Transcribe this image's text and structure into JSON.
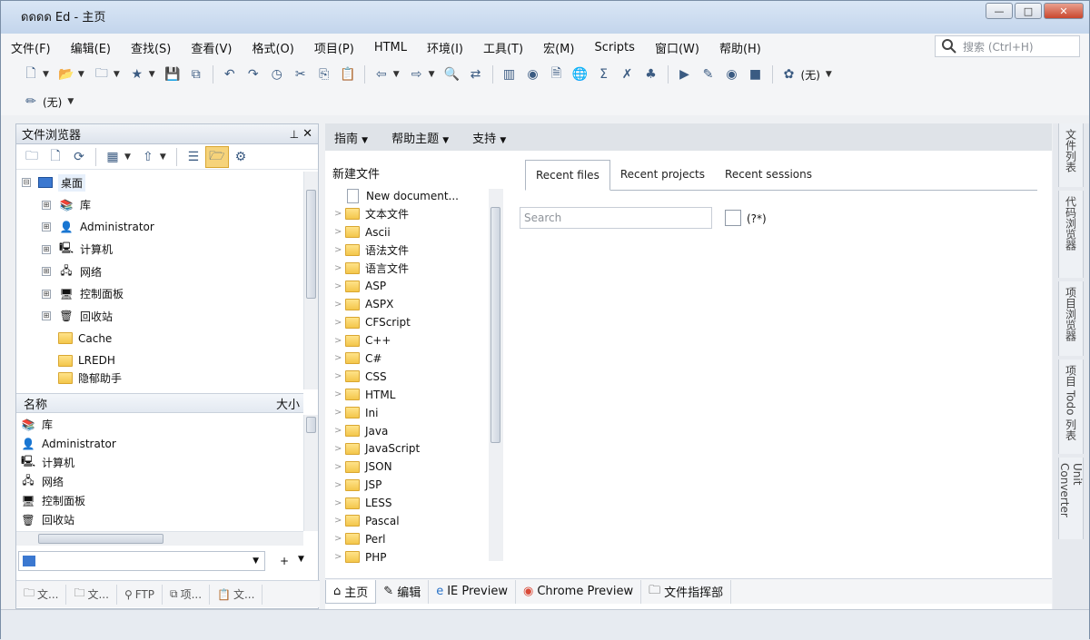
{
  "window": {
    "title_fragment": "Ed - 主页",
    "title_prefix": "ดดดด",
    "minimize": "—",
    "maximize": "□",
    "close": "✕"
  },
  "menu": [
    "文件(F)",
    "编辑(E)",
    "查找(S)",
    "查看(V)",
    "格式(O)",
    "项目(P)",
    "HTML",
    "环境(I)",
    "工具(T)",
    "宏(M)",
    "Scripts",
    "窗口(W)",
    "帮助(H)"
  ],
  "search": {
    "placeholder": "搜索 (Ctrl+H)"
  },
  "toolbar2": {
    "style_label": "(无)"
  },
  "toolbar1": {
    "encoding_label": "(无)"
  },
  "file_browser": {
    "title": "文件浏览器",
    "tree": [
      {
        "label": "桌面",
        "expander": "⊟"
      },
      {
        "label": "库",
        "expander": "⊞"
      },
      {
        "label": "Administrator",
        "expander": "⊞"
      },
      {
        "label": "计算机",
        "expander": "⊞"
      },
      {
        "label": "网络",
        "expander": "⊞"
      },
      {
        "label": "控制面板",
        "expander": "⊞"
      },
      {
        "label": "回收站",
        "expander": "⊞"
      },
      {
        "label": "Cache",
        "expander": ""
      },
      {
        "label": "LREDH",
        "expander": ""
      },
      {
        "label": "隐郁助手",
        "expander": ""
      }
    ],
    "list_header": {
      "name": "名称",
      "size": "大小"
    },
    "list": [
      "库",
      "Administrator",
      "计算机",
      "网络",
      "控制面板",
      "回收站"
    ],
    "bottom_tabs": [
      "文...",
      "文...",
      "FTP",
      "项...",
      "文..."
    ]
  },
  "center": {
    "header_menus": [
      "指南",
      "帮助主题",
      "支持"
    ],
    "new_file_title": "新建文件",
    "new_items": [
      "New document...",
      "文本文件",
      "Ascii",
      "语法文件",
      "语言文件",
      "ASP",
      "ASPX",
      "CFScript",
      "C++",
      "C#",
      "CSS",
      "HTML",
      "Ini",
      "Java",
      "JavaScript",
      "JSON",
      "JSP",
      "LESS",
      "Pascal",
      "Perl",
      "PHP"
    ],
    "tabs": [
      "Recent files",
      "Recent projects",
      "Recent sessions"
    ],
    "search_placeholder": "Search",
    "regex_label": "(?*)",
    "bottom_tabs": [
      "主页",
      "编辑",
      "IE Preview",
      "Chrome Preview",
      "文件指挥部"
    ]
  },
  "right_tabs": [
    "文件列表",
    "代码浏览器",
    "项目浏览器",
    "项目 Todo 列表",
    "Unit Converter"
  ]
}
